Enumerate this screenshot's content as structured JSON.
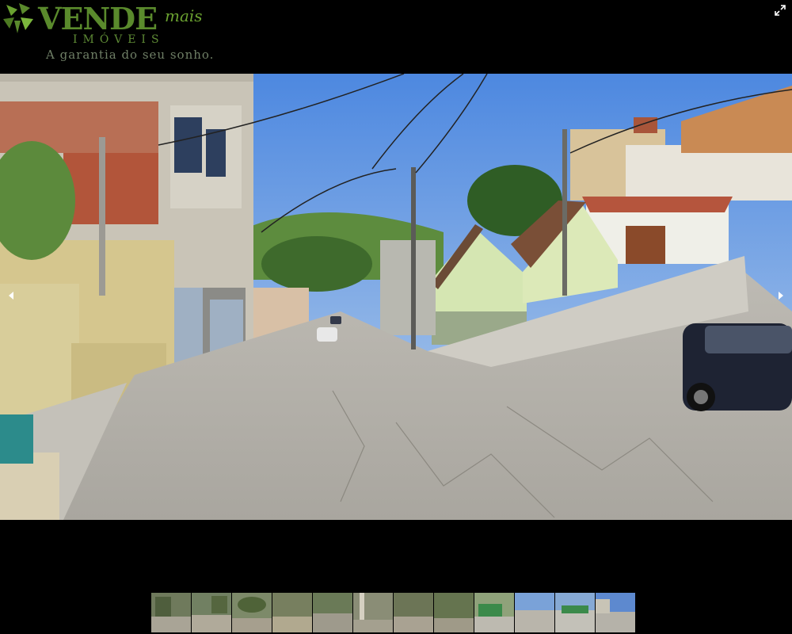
{
  "logo": {
    "brand": "VENDE",
    "brand_suffix": "mais",
    "subtitle": "IMÓVEIS",
    "tagline": "A garantia do seu sonho."
  },
  "controls": {
    "fullscreen_icon": "fullscreen-icon",
    "prev_icon": "arrow-left-icon",
    "next_icon": "arrow-right-icon"
  },
  "colors": {
    "background": "#000000",
    "brand_green": "#5a8a2c"
  },
  "thumbnails": [
    {
      "label": "photo 1"
    },
    {
      "label": "photo 2"
    },
    {
      "label": "photo 3"
    },
    {
      "label": "photo 4"
    },
    {
      "label": "photo 5"
    },
    {
      "label": "photo 6"
    },
    {
      "label": "photo 7"
    },
    {
      "label": "photo 8"
    },
    {
      "label": "photo 9"
    },
    {
      "label": "photo 10"
    },
    {
      "label": "photo 11"
    },
    {
      "label": "photo 12"
    }
  ]
}
